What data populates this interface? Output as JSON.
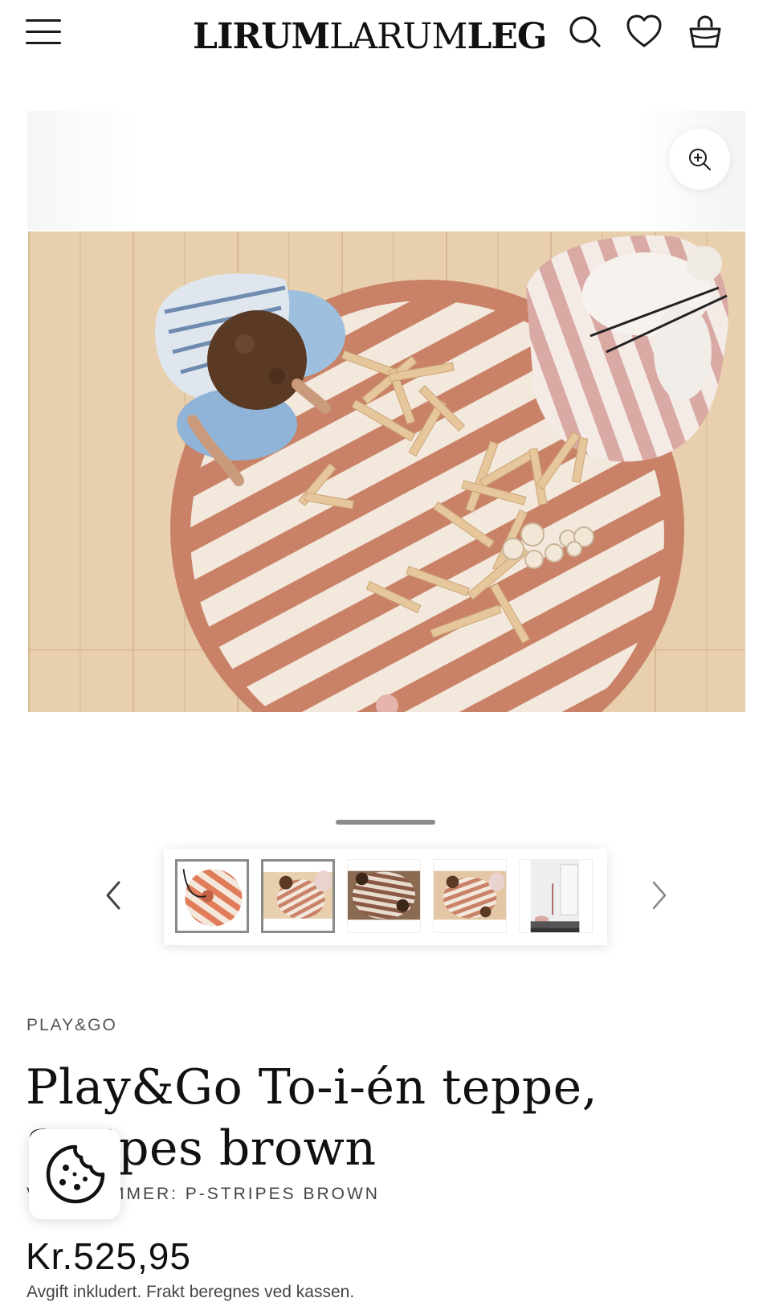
{
  "header": {
    "logo_bold_1": "LIRUM",
    "logo_thin": "LARUM",
    "logo_bold_2": "LEG",
    "icons": [
      "menu-icon",
      "search-icon",
      "heart-icon",
      "bag-icon"
    ]
  },
  "gallery": {
    "main_image_alt": "Play&Go To-i-én teppe, Stripes brown",
    "thumbnails": [
      {
        "name": "thumb-1",
        "selected": false
      },
      {
        "name": "thumb-2",
        "selected": true
      },
      {
        "name": "thumb-3",
        "selected": false
      },
      {
        "name": "thumb-4",
        "selected": false
      },
      {
        "name": "thumb-5",
        "selected": false
      }
    ]
  },
  "product": {
    "brand": "PLAY&GO",
    "title": "Play&Go To-i-én teppe, Stripes brown",
    "variant_label": "VARENUMMER: P-STRIPES BROWN",
    "price": "Kr.525,95",
    "tax_note": "Avgift inkludert. Frakt beregnes ved kassen."
  },
  "colors": {
    "accent": "#1a1a1a",
    "stripe_brown": "#c98268",
    "floor": "#e8cfae"
  }
}
